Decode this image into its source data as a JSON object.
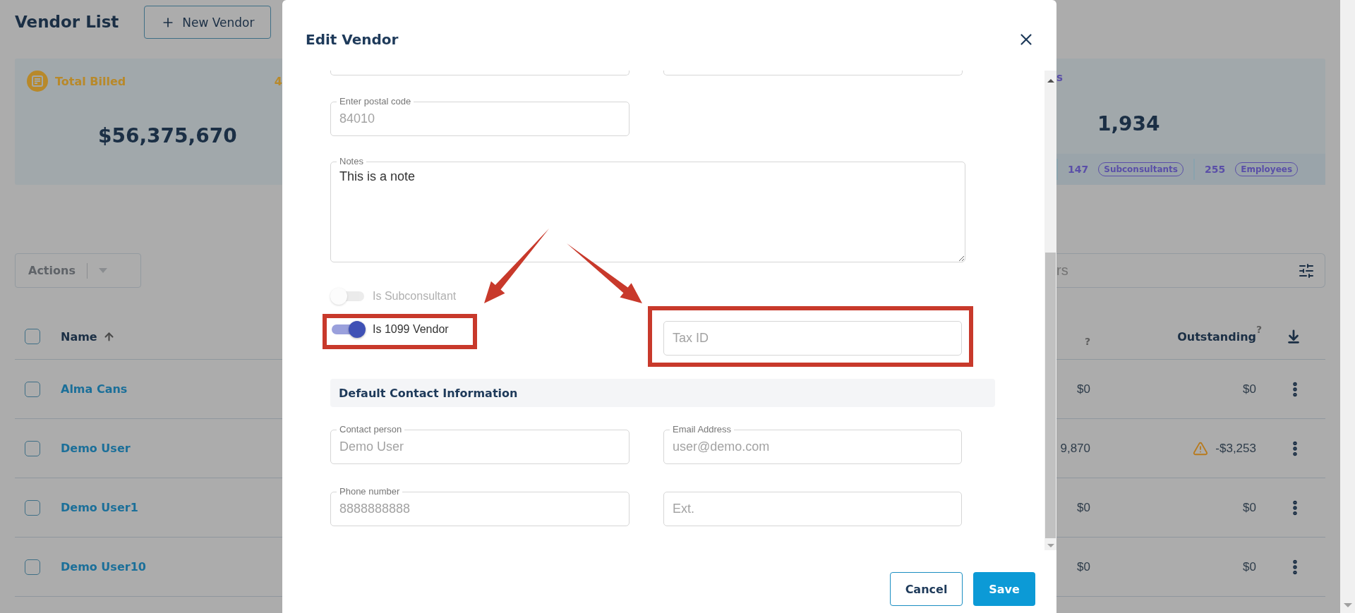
{
  "page": {
    "title": "Vendor List",
    "new_button": "New Vendor",
    "total_billed": {
      "label": "Total Billed",
      "value": "$56,375,670",
      "column_2": "4"
    },
    "vendor_stat": {
      "label": "s",
      "value": "1,934",
      "counts": [
        {
          "count": "147",
          "tag": "Subconsultants"
        },
        {
          "count": "255",
          "tag": "Employees"
        }
      ]
    },
    "actions": "Actions",
    "search": {
      "placeholder": "rs"
    },
    "table": {
      "columns": {
        "name": {
          "label": "Name",
          "sort_ascending": true
        },
        "column_2": {
          "hint": "?"
        },
        "outstanding": {
          "label": "Outstanding",
          "hint": "?"
        }
      },
      "header_selected": false,
      "rows": [
        {
          "name": "Alma Cans",
          "selected": false,
          "column_2": "$0",
          "outstanding": "$0",
          "warning": false
        },
        {
          "name": "Demo User",
          "selected": false,
          "column_2": "9,870",
          "outstanding": "-$3,253",
          "warning": true
        },
        {
          "name": "Demo User1",
          "selected": false,
          "column_2": "$0",
          "outstanding": "$0",
          "warning": false
        },
        {
          "name": "Demo User10",
          "selected": false,
          "column_2": "$0",
          "outstanding": "$0",
          "warning": false
        }
      ]
    }
  },
  "modal": {
    "title": "Edit Vendor",
    "postal": {
      "label": "Enter postal code",
      "value": "84010",
      "disabled": true
    },
    "notes": {
      "label": "Notes",
      "value": "This is a note"
    },
    "toggles": [
      {
        "label": "Is Subconsultant",
        "on": false,
        "disabled": true
      },
      {
        "label": "Is 1099 Vendor",
        "on": true,
        "disabled": false
      }
    ],
    "tax_id": {
      "placeholder": "Tax ID"
    },
    "section": "Default Contact Information",
    "contact_fields": [
      {
        "label": "Contact person",
        "value": "Demo User",
        "disabled": true
      },
      {
        "label": "Email Address",
        "value": "user@demo.com",
        "disabled": true
      },
      {
        "label": "Phone number",
        "value": "8888888888",
        "disabled": true
      },
      {
        "placeholder": "Ext."
      }
    ],
    "buttons": {
      "cancel": "Cancel",
      "save": "Save"
    }
  }
}
